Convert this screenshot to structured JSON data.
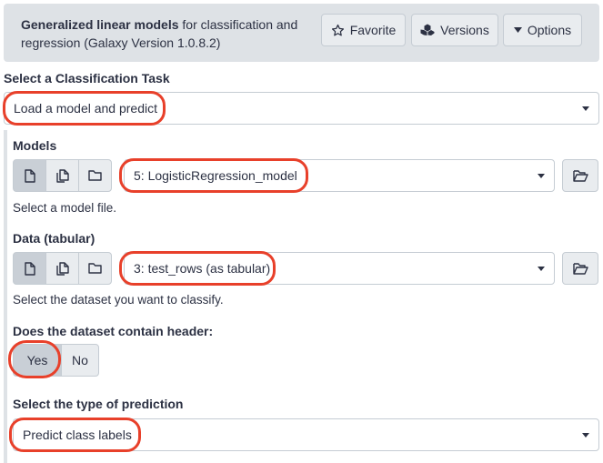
{
  "header": {
    "tool_name": "Generalized linear models",
    "tool_description": " for classification and regression (Galaxy Version 1.0.8.2)",
    "favorite_label": "Favorite",
    "versions_label": "Versions",
    "options_label": "Options"
  },
  "task": {
    "label": "Select a Classification Task",
    "value": "Load a model and predict"
  },
  "models": {
    "label": "Models",
    "value": "5: LogisticRegression_model",
    "help": "Select a model file."
  },
  "data": {
    "label": "Data (tabular)",
    "value": "3: test_rows (as tabular)",
    "help": "Select the dataset you want to classify."
  },
  "header_question": {
    "label": "Does the dataset contain header:",
    "yes_label": "Yes",
    "no_label": "No",
    "selected": "Yes"
  },
  "prediction": {
    "label": "Select the type of prediction",
    "value": "Predict class labels"
  },
  "icons": [
    "star-icon",
    "versions-icon",
    "caret-down-icon",
    "file-icon",
    "files-icon",
    "folder-icon",
    "folder-open-icon"
  ],
  "colors": {
    "header_bg": "#dee2e6",
    "button_bg": "#e9ecef",
    "active_bg": "#c9cfd6",
    "text": "#2c3143",
    "highlight": "#e8402a"
  }
}
